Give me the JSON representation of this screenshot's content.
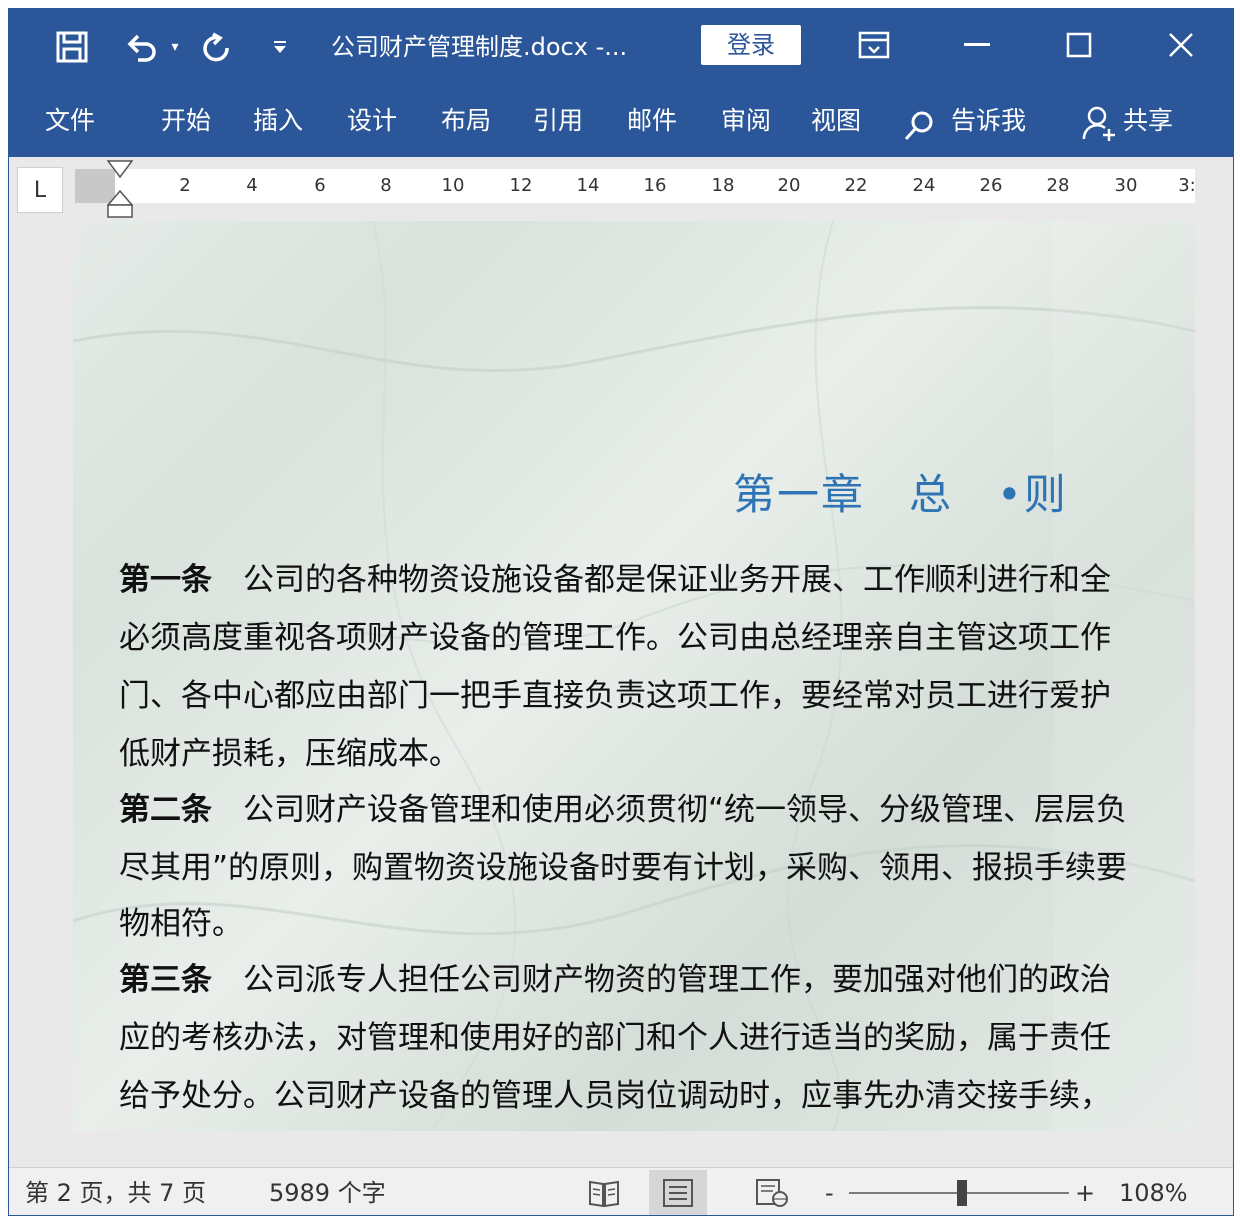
{
  "window": {
    "doc_title": "公司财产管理制度.docx  -...",
    "login_label": "登录"
  },
  "icons": {
    "save": "save-icon",
    "undo": "undo-icon",
    "redo": "redo-icon",
    "customize": "customize-quick-access-icon",
    "ribbon_display": "ribbon-display-options-icon",
    "minimize": "minimize-icon",
    "maximize": "maximize-icon",
    "close": "close-icon",
    "tell_me": "search-icon",
    "share": "share-user-icon"
  },
  "ribbon": {
    "tabs": [
      "文件",
      "开始",
      "插入",
      "设计",
      "布局",
      "引用",
      "邮件",
      "审阅",
      "视图"
    ],
    "tell_me": "告诉我",
    "share": "共享"
  },
  "ruler": {
    "tab_selector": "L",
    "numbers": [
      "2",
      "4",
      "6",
      "8",
      "10",
      "12",
      "14",
      "16",
      "18",
      "20",
      "22",
      "24",
      "26",
      "28",
      "30",
      "3:"
    ]
  },
  "document": {
    "chapter_title": "第一章　总　•则",
    "paragraphs": [
      {
        "head": "第一条",
        "text": "　公司的各种物资设施设备都是保证业务开展、工作顺利进行和全"
      },
      {
        "head": "",
        "text": "必须高度重视各项财产设备的管理工作。公司由总经理亲自主管这项工作"
      },
      {
        "head": "",
        "text": "门、各中心都应由部门一把手直接负责这项工作，要经常对员工进行爱护"
      },
      {
        "head": "",
        "text": "低财产损耗，压缩成本。"
      },
      {
        "head": "第二条",
        "text": "　公司财产设备管理和使用必须贯彻“统一领导、分级管理、层层负"
      },
      {
        "head": "",
        "text": "尽其用”的原则，购置物资设施设备时要有计划，采购、领用、报损手续要"
      },
      {
        "head": "",
        "text": "物相符。"
      },
      {
        "head": "第三条",
        "text": "　公司派专人担任公司财产物资的管理工作，要加强对他们的政治"
      },
      {
        "head": "",
        "text": "应的考核办法，对管理和使用好的部门和个人进行适当的奖励，属于责任"
      },
      {
        "head": "",
        "text": "给予处分。公司财产设备的管理人员岗位调动时，应事先办清交接手续，"
      }
    ]
  },
  "status": {
    "page_info": "第 2 页，共 7 页",
    "word_count": "5989 个字",
    "zoom_minus": "-",
    "zoom_plus": "+",
    "zoom_level": "108%",
    "zoom_percent_value": 108
  },
  "colors": {
    "accent": "#2b579a",
    "heading": "#2e74b5"
  }
}
